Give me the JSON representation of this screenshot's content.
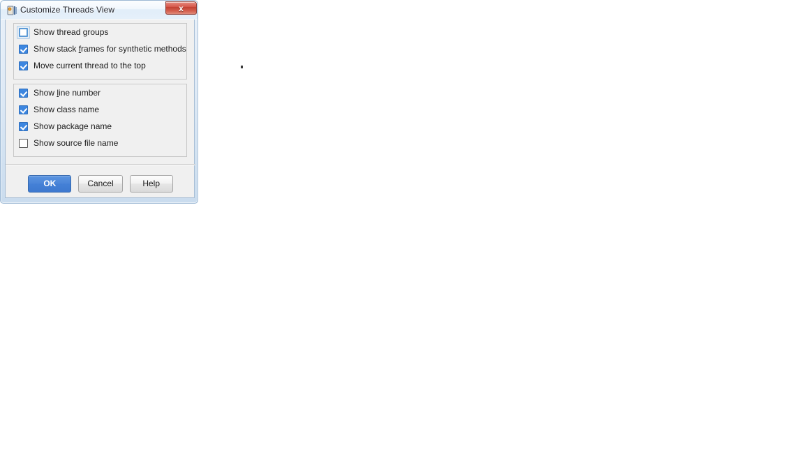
{
  "window": {
    "title": "Customize Threads View",
    "icon": "threads-view-icon",
    "close_label": "x",
    "frame_color": "#cadcee",
    "accent_color": "#3c86e0"
  },
  "groups": [
    {
      "name": "general-options",
      "options": [
        {
          "name": "show-thread-groups",
          "label_before": "Show thread ",
          "mnemonic": "g",
          "label_after": "roups",
          "checked": false,
          "focused": true
        },
        {
          "name": "show-stack-frames-for-synthetic-methods",
          "label_before": "Show stack ",
          "mnemonic": "f",
          "label_after": "rames for synthetic methods",
          "checked": true,
          "focused": false
        },
        {
          "name": "move-current-thread-to-the-top",
          "label_before": "Move current thread to the top",
          "mnemonic": "",
          "label_after": "",
          "checked": true,
          "focused": false
        }
      ]
    },
    {
      "name": "frame-display-options",
      "options": [
        {
          "name": "show-line-number",
          "label_before": "Show ",
          "mnemonic": "l",
          "label_after": "ine number",
          "checked": true,
          "focused": false
        },
        {
          "name": "show-class-name",
          "label_before": "Show class name",
          "mnemonic": "",
          "label_after": "",
          "checked": true,
          "focused": false
        },
        {
          "name": "show-package-name",
          "label_before": "Show package name",
          "mnemonic": "",
          "label_after": "",
          "checked": true,
          "focused": false
        },
        {
          "name": "show-source-file-name",
          "label_before": "Show source file name",
          "mnemonic": "",
          "label_after": "",
          "checked": false,
          "focused": false
        }
      ]
    }
  ],
  "buttons": [
    {
      "name": "ok-button",
      "label": "OK",
      "default": true
    },
    {
      "name": "cancel-button",
      "label": "Cancel",
      "default": false
    },
    {
      "name": "help-button",
      "label": "Help",
      "default": false
    }
  ]
}
